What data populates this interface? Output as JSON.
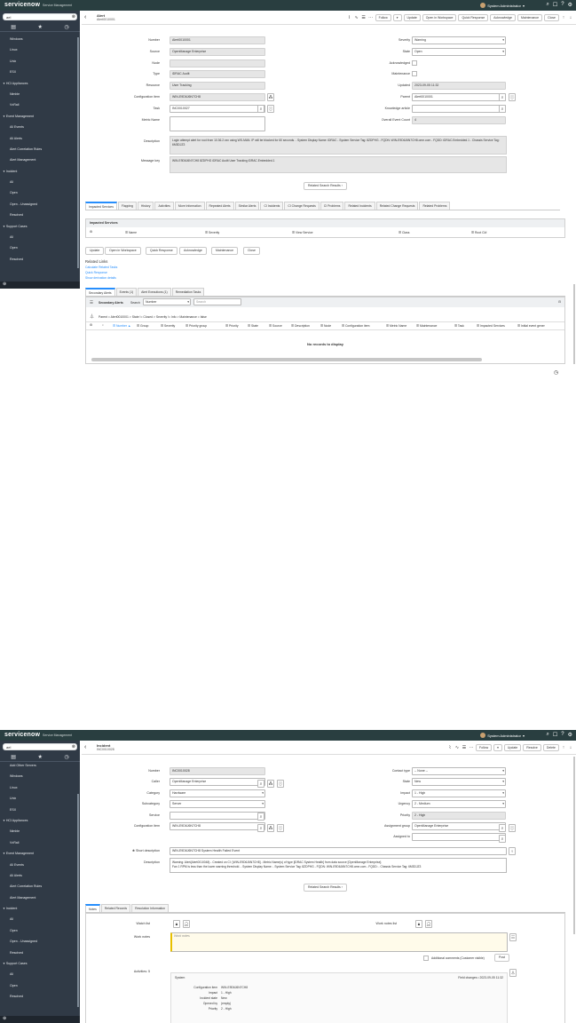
{
  "app": {
    "logo": "servicenow",
    "product": "Service Management",
    "user": "System Administrator"
  },
  "nav": {
    "filter": "ael",
    "items1": [
      "Windows",
      "Linux",
      "Unix",
      "ESX",
      "HCI Appliances",
      "Nimble",
      "VxRail",
      "Event Management",
      "All Events",
      "All Alerts",
      "Alert Correlation Rules",
      "Alert Management",
      "Incident",
      "All",
      "Open",
      "Open - Unassigned",
      "Resolved",
      "Support Cases",
      "All",
      "Open",
      "Resolved"
    ],
    "items2": [
      "Add Other Servers",
      "Windows",
      "Linux",
      "Unix",
      "ESX",
      "HCI Appliances",
      "Nimble",
      "VxRail",
      "Event Management",
      "All Events",
      "All Alerts",
      "Alert Correlation Rules",
      "Alert Management",
      "Incident",
      "All",
      "Open",
      "Open - Unassigned",
      "Resolved",
      "Support Cases",
      "All",
      "Open",
      "Resolved"
    ]
  },
  "alert": {
    "title": "Alert",
    "number": "Alert0010001",
    "buttons": [
      "Follow",
      "Update",
      "Open in Workspace",
      "Quick Response",
      "Acknowledge",
      "Maintenance",
      "Close"
    ],
    "fields_left": [
      {
        "label": "Number",
        "value": "Alert0010001"
      },
      {
        "label": "Source",
        "value": "OpenManage Enterprise"
      },
      {
        "label": "Node",
        "value": ""
      },
      {
        "label": "Type",
        "value": "iDRAC Audit"
      },
      {
        "label": "Resource",
        "value": "User Tracking"
      },
      {
        "label": "Configuration item",
        "value": "WIN-E9D6J6N7CH8"
      },
      {
        "label": "Task",
        "value": "INC0010027"
      },
      {
        "label": "Metric Name",
        "value": ""
      }
    ],
    "fields_right": [
      {
        "label": "Severity",
        "value": "Warning"
      },
      {
        "label": "State",
        "value": "Open"
      },
      {
        "label": "Acknowledged",
        "value": ""
      },
      {
        "label": "Maintenance",
        "value": ""
      },
      {
        "label": "Updated",
        "value": "2023-09-05 11:32"
      },
      {
        "label": "Parent",
        "value": "Alert0010001"
      },
      {
        "label": "Knowledge article",
        "value": ""
      },
      {
        "label": "Overall Event Count",
        "value": "4"
      }
    ],
    "description_label": "Description",
    "description": "Login attempt alert for root from 10.36.2.xxx using WS-MAN. IP will be blocked for 60 seconds. - System Display Name: iDRAC - System Service Tag: 8ZDPHG - FQDN: WIN-E9D6J6N7CH8.ome.com - FQDD: iDRAC.Embedded.1 - Chassis Service Tag: 6M3DJZ3",
    "message_key_label": "Message key",
    "message_key": "WIN-E9D6J6N7CH8 8ZDPHG iDRAC Audit User Tracking iDRAC.Embedded.1",
    "related_search": "Related Search Results",
    "tabs": [
      "Impacted Services",
      "Flapping",
      "History",
      "Activities",
      "More Information",
      "Repeated Alerts",
      "Similar Alerts",
      "CI Incidents",
      "CI Change Requests",
      "CI Problems",
      "Related Incidents",
      "Related Change Requests",
      "Related Problems"
    ],
    "impacted_header": "Impacted Services",
    "impacted_cols": [
      "Name",
      "Severity",
      "View Service",
      "Class",
      "Root CI#"
    ],
    "bottom_buttons": [
      "Update",
      "Open in Workspace",
      "Quick Response",
      "Acknowledge",
      "Maintenance",
      "Close"
    ],
    "related_links_title": "Related Links",
    "related_links": [
      "Calculate Related Tasks",
      "Quick Response",
      "Show derivation details"
    ],
    "sec_tabs": [
      "Secondary Alerts",
      "Events (1)",
      "Alert Executions (1)",
      "Remediation Tasks"
    ],
    "sec_list_title": "Secondary Alerts",
    "sec_search_label": "Search",
    "sec_search_field": "Number",
    "sec_search_placeholder": "Search",
    "sec_breadcrumb": "Parent = Alert0010001 > State != Closed > Severity != Info > Maintenance = false",
    "sec_cols": [
      "Number ▲",
      "Group",
      "Severity",
      "Priority group",
      "Priority",
      "State",
      "Source",
      "Description",
      "Node",
      "Configuration item",
      "Metric Name",
      "Maintenance",
      "Task",
      "Impacted Services",
      "Initial event gener"
    ],
    "no_records": "No records to display"
  },
  "incident": {
    "title": "Incident",
    "number": "INC0010028",
    "buttons": [
      "Follow",
      "Update",
      "Resolve",
      "Delete"
    ],
    "left": [
      {
        "label": "Number",
        "value": "INC0010028"
      },
      {
        "label": "Caller",
        "value": "OpenManage Enterprise"
      },
      {
        "label": "Category",
        "value": "Hardware"
      },
      {
        "label": "Subcategory",
        "value": "Server"
      },
      {
        "label": "Service",
        "value": ""
      },
      {
        "label": "Configuration item",
        "value": "WIN-E9D6J6N7CH8"
      }
    ],
    "right": [
      {
        "label": "Contact type",
        "value": "-- None --"
      },
      {
        "label": "State",
        "value": "New"
      },
      {
        "label": "Impact",
        "value": "1 - High"
      },
      {
        "label": "Urgency",
        "value": "2 - Medium"
      },
      {
        "label": "Priority",
        "value": "2 - High"
      },
      {
        "label": "Assignment group",
        "value": "OpenManage Enterprise"
      },
      {
        "label": "Assigned to",
        "value": ""
      }
    ],
    "short_desc_label": "Short description",
    "short_desc": "WIN-E9D6J6N7CH8 System Health Failed Event",
    "desc_label": "Description",
    "desc_line1": "Warning: Alert(Alert0010048) - Created on CI: [WIN-E9D6J6N7CH8] - Metric Name(s) of type [iDRAC System Health] from data source [OpenManage Enterprise].",
    "desc_line2": "Fan 1 RPM is less than the lower warning threshold. - System Display Name: - System Service Tag: 8ZDPHG - FQDN: WIN-E9D6J6N7CH8.ome.com - FQDD: - Chassis Service Tag: 6M3DJZ3",
    "related_search": "Related Search Results",
    "tabs": [
      "Notes",
      "Related Records",
      "Resolution Information"
    ],
    "watch_list": "Watch list",
    "work_notes_list": "Work notes list",
    "work_notes_label": "Work notes",
    "work_notes_placeholder": "Work notes",
    "additional_comments": "Additional comments (Customer visible)",
    "post": "Post",
    "activities": "Activities: 5",
    "act_user": "System",
    "act_meta": "Field changes • 2023-09-05 11:32",
    "act_fields": [
      {
        "k": "Configuration item",
        "v": "WIN-E9D6J6N7CH8"
      },
      {
        "k": "Impact",
        "v": "1 - High"
      },
      {
        "k": "Incident state",
        "v": "New"
      },
      {
        "k": "Opened by",
        "v": "(empty)"
      },
      {
        "k": "Priority",
        "v": "2 - High"
      }
    ]
  }
}
